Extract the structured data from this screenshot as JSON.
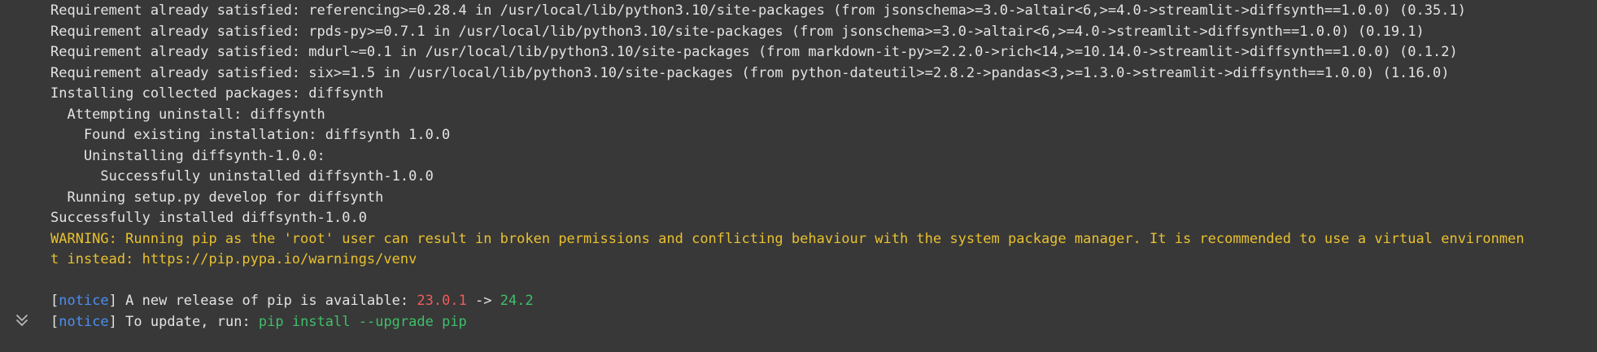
{
  "output": {
    "lines": [
      "Requirement already satisfied: referencing>=0.28.4 in /usr/local/lib/python3.10/site-packages (from jsonschema>=3.0->altair<6,>=4.0->streamlit->diffsynth==1.0.0) (0.35.1)",
      "Requirement already satisfied: rpds-py>=0.7.1 in /usr/local/lib/python3.10/site-packages (from jsonschema>=3.0->altair<6,>=4.0->streamlit->diffsynth==1.0.0) (0.19.1)",
      "Requirement already satisfied: mdurl~=0.1 in /usr/local/lib/python3.10/site-packages (from markdown-it-py>=2.2.0->rich<14,>=10.14.0->streamlit->diffsynth==1.0.0) (0.1.2)",
      "Requirement already satisfied: six>=1.5 in /usr/local/lib/python3.10/site-packages (from python-dateutil>=2.8.2->pandas<3,>=1.3.0->streamlit->diffsynth==1.0.0) (1.16.0)",
      "Installing collected packages: diffsynth",
      "  Attempting uninstall: diffsynth",
      "    Found existing installation: diffsynth 1.0.0",
      "    Uninstalling diffsynth-1.0.0:",
      "      Successfully uninstalled diffsynth-1.0.0",
      "  Running setup.py develop for diffsynth",
      "Successfully installed diffsynth-1.0.0"
    ],
    "warning_line_1": "WARNING: Running pip as the 'root' user can result in broken permissions and conflicting behaviour with the system package manager. It is recommended to use a virtual environmen",
    "warning_line_2": "t instead: https://pip.pypa.io/warnings/venv",
    "notice_1": {
      "open": "[",
      "tag": "notice",
      "close": "]",
      "text": " A new release of pip is available: ",
      "old_version": "23.0.1",
      "arrow": " -> ",
      "new_version": "24.2"
    },
    "notice_2": {
      "open": "[",
      "tag": "notice",
      "close": "]",
      "text": " To update, run: ",
      "command": "pip install --upgrade pip"
    }
  },
  "colors": {
    "background": "#383838",
    "text": "#e3e3e3",
    "warning": "#e8c02f",
    "notice_tag": "#4b8ff0",
    "old_version": "#ef5b5b",
    "new_version": "#3fbf6a"
  },
  "icons": {
    "collapse": "double-chevron-down-icon"
  }
}
